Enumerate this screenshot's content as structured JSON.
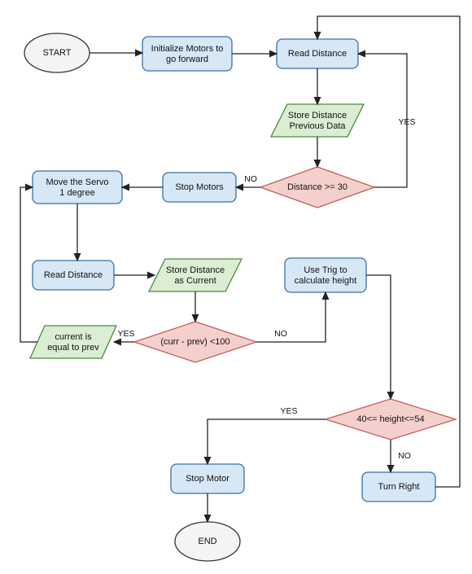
{
  "diagram": {
    "type": "flowchart",
    "nodes": {
      "start": {
        "label": "START",
        "shape": "terminal"
      },
      "init_motors": {
        "line1": "Initialize Motors to",
        "line2": "go forward",
        "shape": "process"
      },
      "read_dist_1": {
        "label": "Read Distance",
        "shape": "process"
      },
      "store_prev": {
        "line1": "Store Distance",
        "line2": "Previous Data",
        "shape": "data"
      },
      "dec_dist30": {
        "label": "Distance >= 30",
        "shape": "decision"
      },
      "stop_motors_1": {
        "label": "Stop Motors",
        "shape": "process"
      },
      "move_servo": {
        "line1": "Move the Servo",
        "line2": "1 degree",
        "shape": "process"
      },
      "read_dist_2": {
        "label": "Read Distance",
        "shape": "process"
      },
      "store_curr": {
        "line1": "Store Distance",
        "line2": "as Current",
        "shape": "data"
      },
      "dec_diff100": {
        "label": "(curr - prev) <100",
        "shape": "decision"
      },
      "curr_eq_prev": {
        "line1": "current is",
        "line2": "equal to prev",
        "shape": "data"
      },
      "use_trig": {
        "line1": "Use Trig to",
        "line2": "calculate height",
        "shape": "process"
      },
      "dec_height": {
        "label": "40<= height<=54",
        "shape": "decision"
      },
      "stop_motor_2": {
        "label": "Stop Motor",
        "shape": "process"
      },
      "turn_right": {
        "label": "Turn Right",
        "shape": "process"
      },
      "end": {
        "label": "END",
        "shape": "terminal"
      }
    },
    "edge_labels": {
      "yes1": "YES",
      "no1": "NO",
      "yes2": "YES",
      "no2": "NO",
      "yes3": "YES",
      "no3": "NO"
    }
  }
}
